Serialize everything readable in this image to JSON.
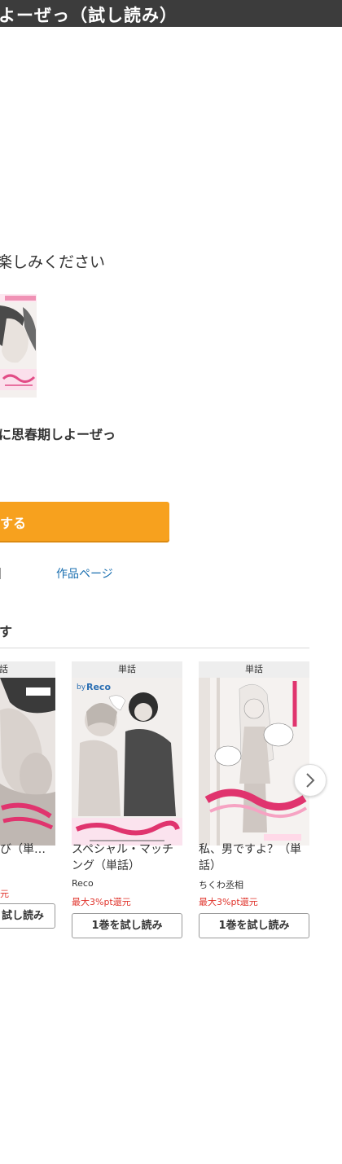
{
  "header": {
    "title": "よーぜっ（試し読み）"
  },
  "main": {
    "enjoy_text": "楽しみください",
    "book_title": "に思春期しよーぜっ",
    "buy_button_label": "する",
    "work_page_link": "作品ページ"
  },
  "recommend": {
    "heading": "す",
    "cards": [
      {
        "badge": "話",
        "title": "び（単…",
        "author": "",
        "point": "元",
        "trial_label": "試し読み"
      },
      {
        "badge": "単話",
        "title": "スペシャル・マッチング（単話）",
        "author": "Reco",
        "point": "最大3%pt還元",
        "trial_label": "1巻を試し読み"
      },
      {
        "badge": "単話",
        "title": "私、男ですよ？（単話）",
        "author": "ちくわ丞相",
        "point": "最大3%pt還元",
        "trial_label": "1巻を試し読み"
      }
    ]
  },
  "colors": {
    "header_bg": "#3c3c3c",
    "buy_button": "#f7a11e",
    "link": "#1a6fb0",
    "point_text": "#e0342c"
  }
}
